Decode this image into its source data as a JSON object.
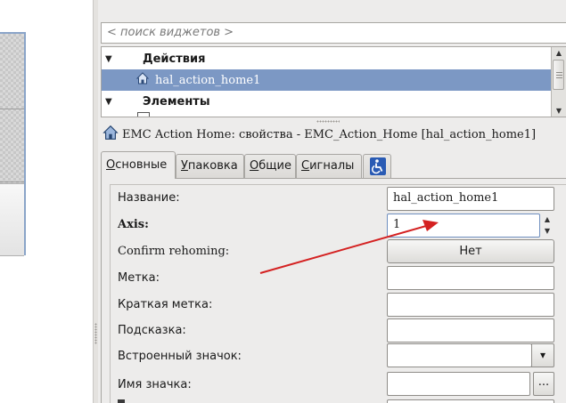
{
  "search": {
    "placeholder": "< поиск виджетов >"
  },
  "tree": {
    "categories": [
      {
        "label": "Действия",
        "expanded": true
      },
      {
        "label": "Элементы",
        "expanded": true
      }
    ],
    "selected_item": "hal_action_home1"
  },
  "properties": {
    "title": "EMC Action Home: свойства - EMC_Action_Home [hal_action_home1]",
    "tabs": [
      {
        "label": "Основные",
        "mnemonic": "О",
        "rest": "сновные",
        "active": true
      },
      {
        "label": "Упаковка",
        "mnemonic": "У",
        "rest": "паковка",
        "active": false
      },
      {
        "label": "Общие",
        "mnemonic": "О",
        "rest": "бщие",
        "active": false
      },
      {
        "label": "Сигналы",
        "mnemonic": "С",
        "rest": "игналы",
        "active": false
      },
      {
        "label": "",
        "icon": "accessibility-icon",
        "active": false
      }
    ],
    "fields": {
      "name_label": "Название:",
      "name_value": "hal_action_home1",
      "axis_label": "Axis:",
      "axis_value": "1",
      "confirm_label": "Confirm rehoming:",
      "confirm_value": "Нет",
      "label_label": "Метка:",
      "short_label_label": "Краткая метка:",
      "tooltip_label": "Подсказка:",
      "stock_icon_label": "Встроенный значок:",
      "icon_name_label": "Имя значка:",
      "browse_label": "..."
    }
  },
  "colors": {
    "selection": "#7c98c4",
    "annotation_arrow": "#d42121"
  }
}
